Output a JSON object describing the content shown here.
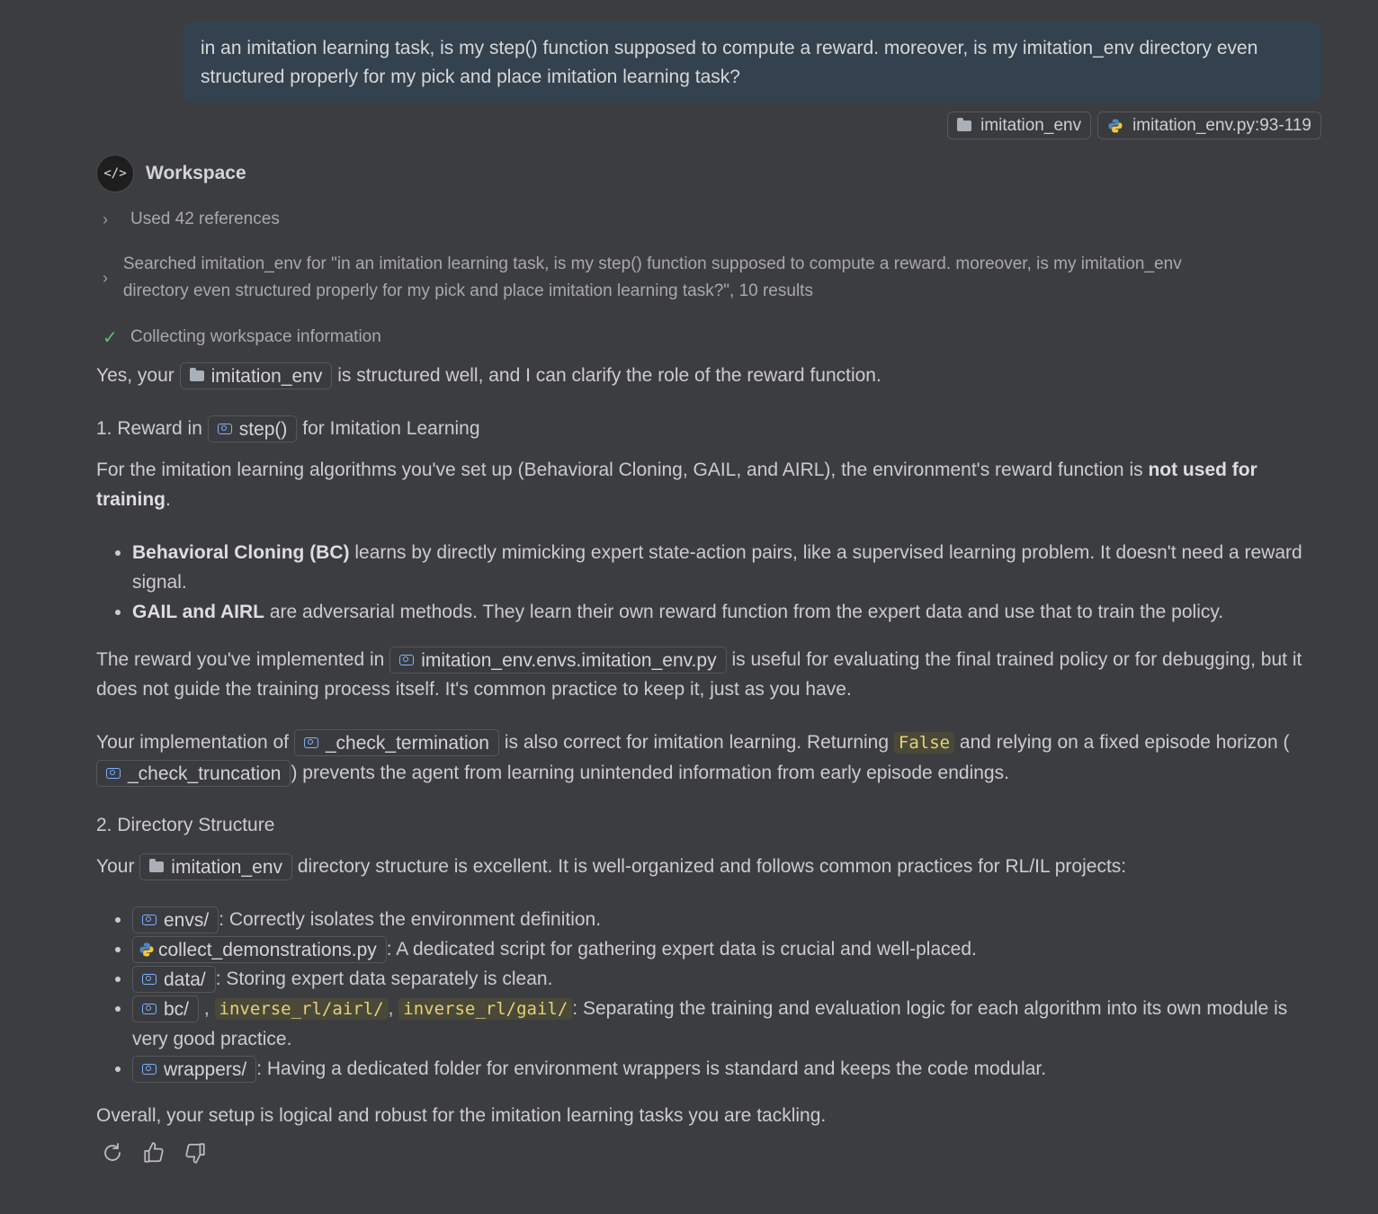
{
  "user_message": "in an imitation learning task, is my step() function supposed to compute a reward. moreover, is my imitation_env directory even structured properly for my pick and place imitation learning task?",
  "attachments": [
    {
      "label": "imitation_env",
      "icon": "folder-icon"
    },
    {
      "label": "imitation_env.py:93-119",
      "icon": "python-icon"
    }
  ],
  "workspace": {
    "avatar_glyph": "</>",
    "title": "Workspace",
    "steps": [
      "Used 42 references",
      "Searched imitation_env for \"in an imitation learning task, is my step() function supposed to compute a reward. moreover, is my imitation_env directory even structured properly for my pick and place imitation learning task?\", 10 results",
      "Collecting workspace information"
    ]
  },
  "answer": {
    "intro_pre": "Yes, your",
    "intro_chip": "imitation_env",
    "intro_post": "is structured well, and I can clarify the role of the reward function.",
    "h1_pre": "1. Reward in",
    "h1_chip": "step()",
    "h1_post": "for Imitation Learning",
    "p1_pre": "For the imitation learning algorithms you've set up (Behavioral Cloning, GAIL, and AIRL), the environment's reward function is",
    "p1_bold": "not used for training",
    "p1_post": ".",
    "bullet1_bold": "Behavioral Cloning (BC)",
    "bullet1_text": "learns by directly mimicking expert state-action pairs, like a supervised learning problem. It doesn't need a reward signal.",
    "bullet2_bold": "GAIL and AIRL",
    "bullet2_text": "are adversarial methods. They learn their own reward function from the expert data and use that to train the policy.",
    "p2_pre": "The reward you've implemented in",
    "p2_chip": "imitation_env.envs.imitation_env.py",
    "p2_post": "is useful for evaluating the final trained policy or for debugging, but it does not guide the training process itself. It's common practice to keep it, just as you have.",
    "p3_pre": "Your implementation of",
    "p3_chip1": "_check_termination",
    "p3_mid1": "is also correct for imitation learning. Returning",
    "p3_code": "False",
    "p3_mid2": "and relying on a fixed episode horizon (",
    "p3_chip2": "_check_truncation",
    "p3_post": ") prevents the agent from learning unintended information from early episode endings.",
    "h2": "2. Directory Structure",
    "p4_pre": "Your",
    "p4_chip": "imitation_env",
    "p4_post": "directory structure is excellent. It is well-organized and follows common practices for RL/IL projects:",
    "dir_items": [
      {
        "chip": "envs/",
        "text": ": Correctly isolates the environment definition."
      },
      {
        "chip": "collect_demonstrations.py",
        "text": ": A dedicated script for gathering expert data is crucial and well-placed."
      },
      {
        "chip": "data/",
        "text": ": Storing expert data separately is clean."
      },
      {
        "chip": "bc/",
        "comma": ",",
        "code1": "inverse_rl/airl/",
        "comma2": ",",
        "code2": "inverse_rl/gail/",
        "text": ": Separating the training and evaluation logic for each algorithm into its own module is very good practice."
      },
      {
        "chip": "wrappers/",
        "text": ": Having a dedicated folder for environment wrappers is standard and keeps the code modular."
      }
    ],
    "conclusion": "Overall, your setup is logical and robust for the imitation learning tasks you are tackling."
  },
  "actions": [
    "retry-icon",
    "thumbs-up-icon",
    "thumbs-down-icon"
  ]
}
